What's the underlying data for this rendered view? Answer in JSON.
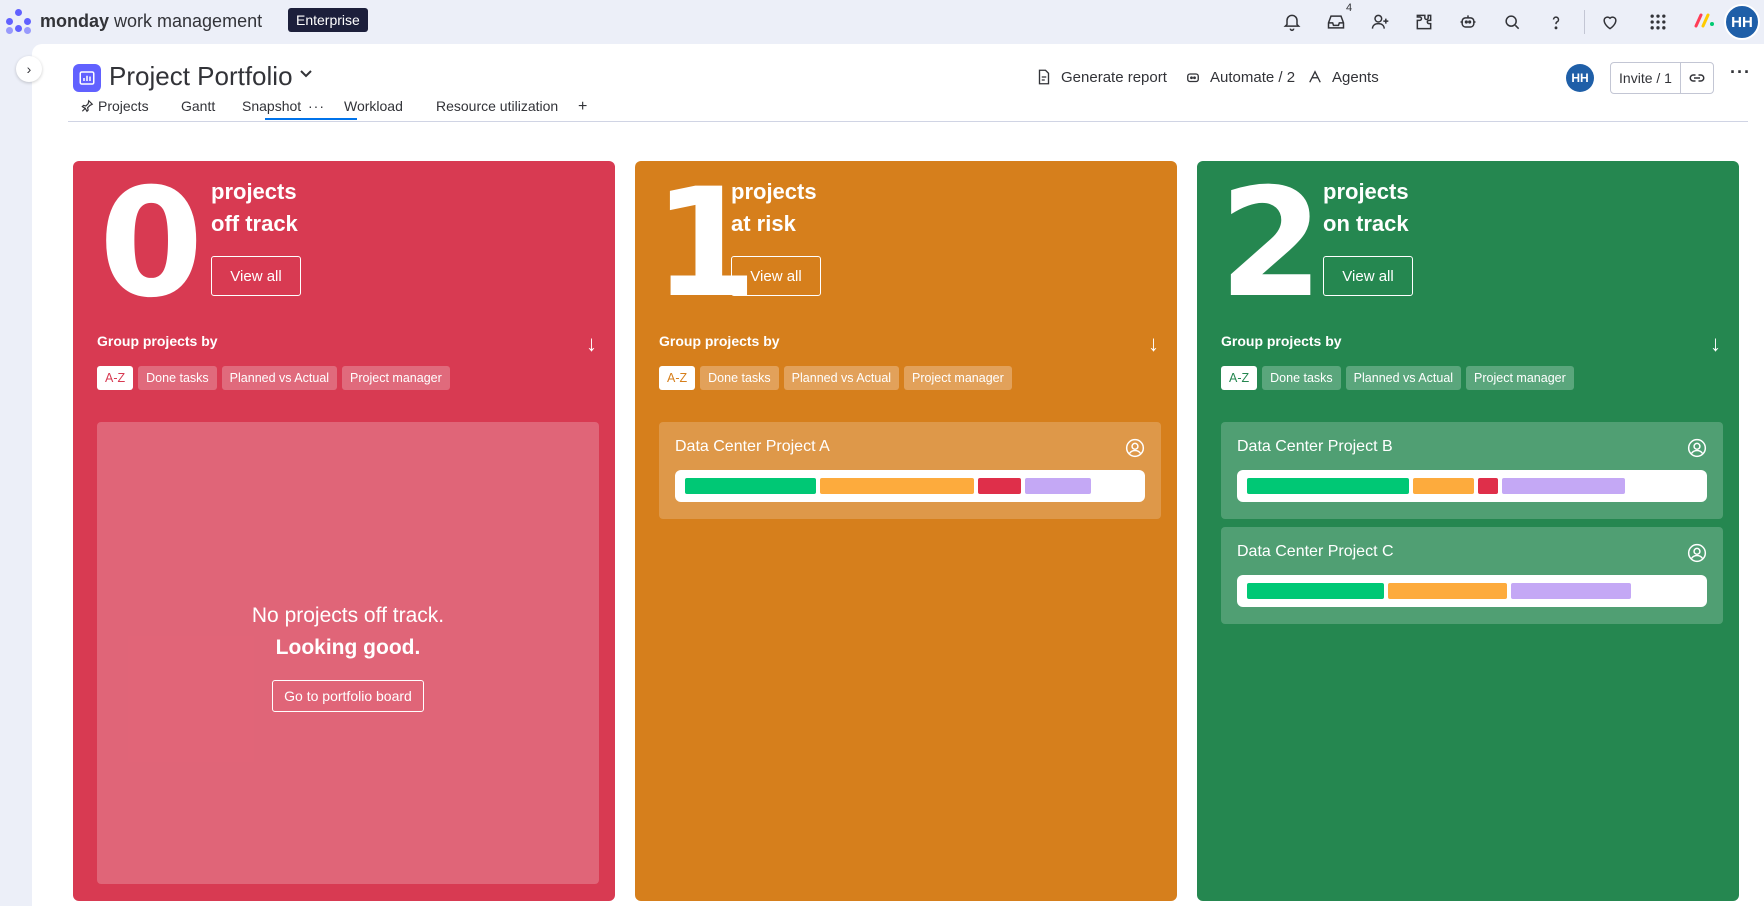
{
  "app": {
    "brand_bold": "monday",
    "brand_rest": " work management",
    "plan_badge": "Enterprise",
    "inbox_count": "4",
    "user_initials": "HH"
  },
  "board": {
    "title": "Project Portfolio",
    "actions": {
      "generate_report": "Generate report",
      "automate": "Automate / 2",
      "agents": "Agents",
      "invite": "Invite / 1"
    },
    "tabs": [
      {
        "label": "Projects"
      },
      {
        "label": "Gantt"
      },
      {
        "label": "Snapshot"
      },
      {
        "label": "Workload"
      },
      {
        "label": "Resource utilization"
      }
    ],
    "add_tab": "+"
  },
  "snapshot": {
    "group_by_label": "Group projects by",
    "view_all_label": "View all",
    "chips": [
      "A-Z",
      "Done tasks",
      "Planned vs Actual",
      "Project manager"
    ],
    "cards": [
      {
        "count": "0",
        "line1": "projects",
        "line2": "off track",
        "color": "#d83a52",
        "chip_bg": "#e06a7c",
        "active_chip_text": "#d83a52",
        "empty_line1": "No projects off track.",
        "empty_line2": "Looking good.",
        "empty_button": "Go to portfolio board",
        "projects": []
      },
      {
        "count": "1",
        "line1": "projects",
        "line2": "at risk",
        "color": "#d67f1c",
        "chip_bg": "#e2a15a",
        "active_chip_text": "#d67f1c",
        "projects": [
          {
            "name": "Data Center Project A",
            "segments": [
              {
                "share": 0.3,
                "color": "#00c875"
              },
              {
                "share": 0.35,
                "color": "#fdab3d"
              },
              {
                "share": 0.1,
                "color": "#df2f4a"
              },
              {
                "share": 0.15,
                "color": "#c4a8f5"
              }
            ]
          }
        ]
      },
      {
        "count": "2",
        "line1": "projects",
        "line2": "on track",
        "color": "#258750",
        "chip_bg": "#5aa67c",
        "active_chip_text": "#258750",
        "projects": [
          {
            "name": "Data Center Project B",
            "segments": [
              {
                "share": 0.37,
                "color": "#00c875"
              },
              {
                "share": 0.14,
                "color": "#fdab3d"
              },
              {
                "share": 0.045,
                "color": "#df2f4a"
              },
              {
                "share": 0.28,
                "color": "#c4a8f5"
              }
            ]
          },
          {
            "name": "Data Center Project C",
            "segments": [
              {
                "share": 0.31,
                "color": "#00c875"
              },
              {
                "share": 0.27,
                "color": "#fdab3d"
              },
              {
                "share": 0.27,
                "color": "#c4a8f5"
              }
            ]
          }
        ]
      }
    ]
  }
}
